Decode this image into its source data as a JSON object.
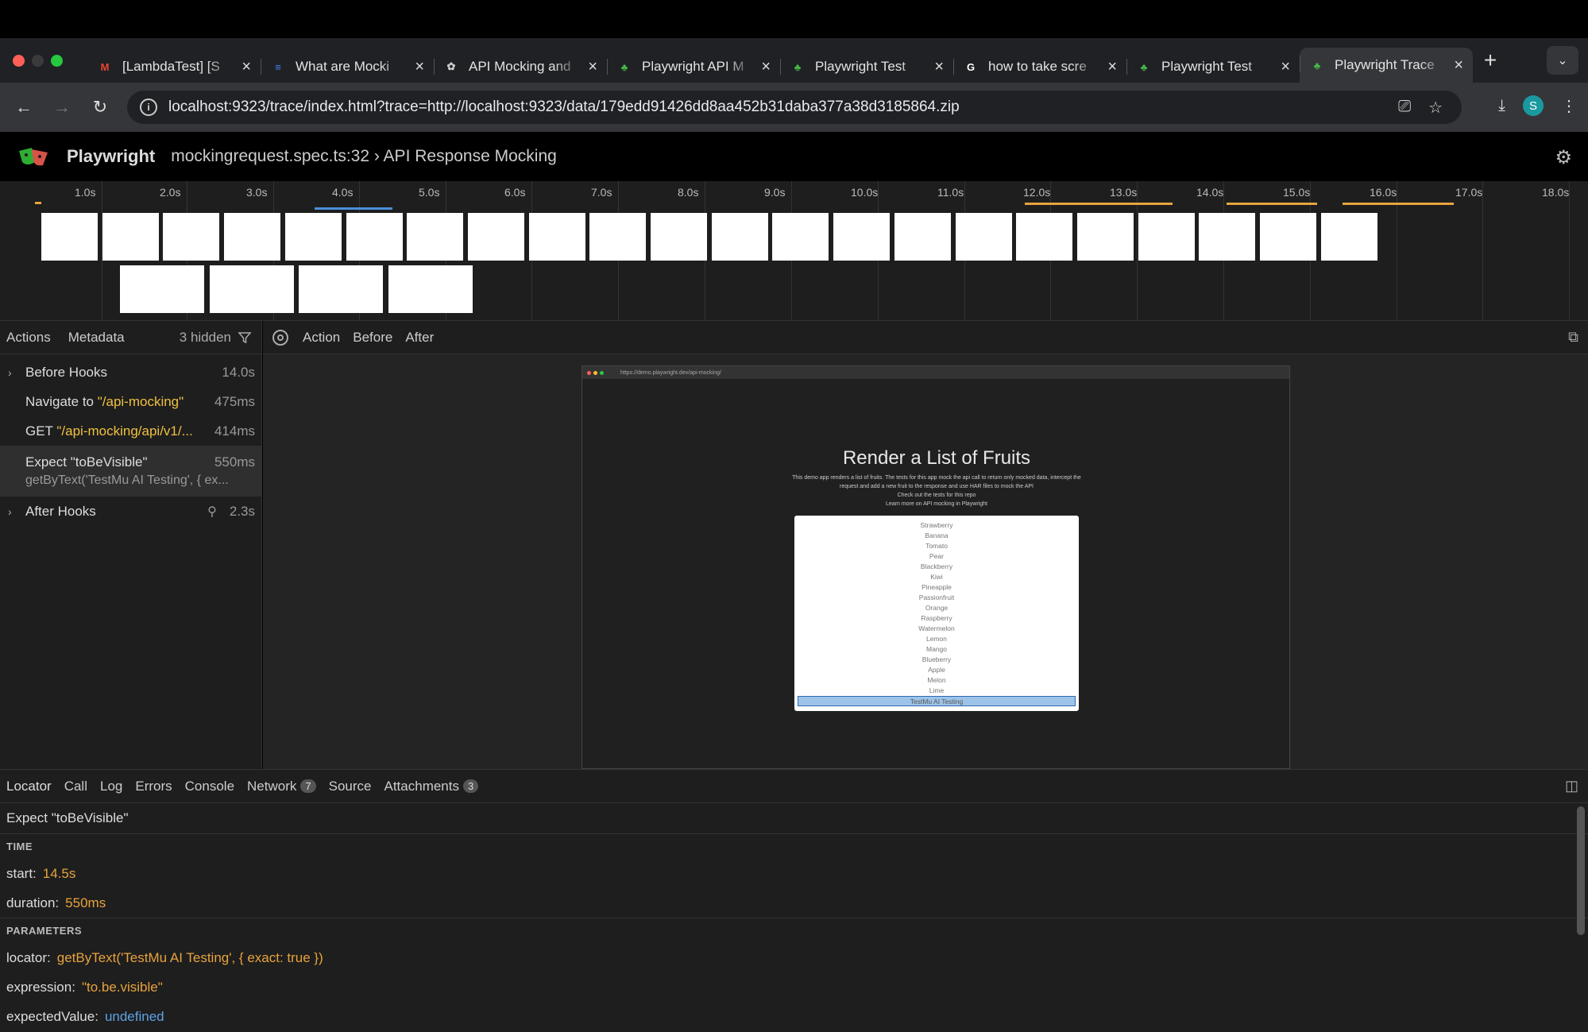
{
  "browser": {
    "tabs": [
      {
        "title": "[LambdaTest] [S",
        "icon": "gmail-icon",
        "color": "#ea4335",
        "glyph": "M"
      },
      {
        "title": "What are Mocki",
        "icon": "docs-icon",
        "color": "#4285f4",
        "glyph": "≡"
      },
      {
        "title": "API Mocking and",
        "icon": "openai-icon",
        "color": "#cccccc",
        "glyph": "✿"
      },
      {
        "title": "Playwright API M",
        "icon": "playwright-icon",
        "color": "#45ba4b",
        "glyph": "♣"
      },
      {
        "title": "Playwright Test",
        "icon": "playwright-icon",
        "color": "#45ba4b",
        "glyph": "♣"
      },
      {
        "title": "how to take scre",
        "icon": "google-icon",
        "color": "#ffffff",
        "glyph": "G"
      },
      {
        "title": "Playwright Test",
        "icon": "playwright-icon",
        "color": "#45ba4b",
        "glyph": "♣"
      },
      {
        "title": "Playwright Trace",
        "icon": "playwright-icon",
        "color": "#45ba4b",
        "glyph": "♣",
        "active": true
      }
    ],
    "url": "localhost:9323/trace/index.html?trace=http://localhost:9323/data/179edd91426dd8aa452b31daba377a38d3185864.zip",
    "profile_initial": "S"
  },
  "header": {
    "app_name": "Playwright",
    "title": "mockingrequest.spec.ts:32 › API Response Mocking"
  },
  "timeline": {
    "labels": [
      "1.0s",
      "2.0s",
      "3.0s",
      "4.0s",
      "5.0s",
      "6.0s",
      "7.0s",
      "8.0s",
      "9.0s",
      "10.0s",
      "11.0s",
      "12.0s",
      "13.0s",
      "14.0s",
      "15.0s",
      "16.0s",
      "17.0s",
      "18.0s"
    ]
  },
  "left_panel": {
    "tabs": [
      "Actions",
      "Metadata"
    ],
    "hidden_label": "3 hidden",
    "actions": [
      {
        "name": "Before Hooks",
        "duration": "14.0s",
        "expandable": true
      },
      {
        "prefix": "Navigate to ",
        "highlight": "\"/api-mocking\"",
        "duration": "475ms"
      },
      {
        "prefix": "GET ",
        "highlight": "\"/api-mocking/api/v1/...",
        "duration": "414ms"
      },
      {
        "name": "Expect \"toBeVisible\"",
        "sub": "getByText('TestMu AI Testing', { ex...",
        "duration": "550ms",
        "selected": true
      },
      {
        "name": "After Hooks",
        "duration": "2.3s",
        "expandable": true,
        "attachment": true
      }
    ]
  },
  "snapshot": {
    "tabs": [
      "Action",
      "Before",
      "After"
    ],
    "url": "https://demo.playwright.dev/api-mocking/",
    "heading": "Render a List of Fruits",
    "paragraph_lines": [
      "This demo app renders a list of fruits. The tests for this app mock the api call to return only mocked data, intercept the",
      "request and add a new fruit to the response and use HAR files to mock the API",
      "Check out the tests for this repo",
      "Learn more on API mocking in Playwright"
    ],
    "fruits": [
      "Strawberry",
      "Banana",
      "Tomato",
      "Pear",
      "Blackberry",
      "Kiwi",
      "Pineapple",
      "Passionfruit",
      "Orange",
      "Raspberry",
      "Watermelon",
      "Lemon",
      "Mango",
      "Blueberry",
      "Apple",
      "Melon",
      "Lime",
      "TestMu AI Testing"
    ]
  },
  "bottom_panel": {
    "tabs": [
      {
        "label": "Locator"
      },
      {
        "label": "Call"
      },
      {
        "label": "Log"
      },
      {
        "label": "Errors"
      },
      {
        "label": "Console"
      },
      {
        "label": "Network",
        "badge": "7"
      },
      {
        "label": "Source"
      },
      {
        "label": "Attachments",
        "badge": "3"
      }
    ],
    "action_title": "Expect \"toBeVisible\"",
    "time_heading": "TIME",
    "start_key": "start:",
    "start_val": "14.5s",
    "duration_key": "duration:",
    "duration_val": "550ms",
    "params_heading": "PARAMETERS",
    "locator_key": "locator:",
    "locator_val": "getByText('TestMu AI Testing', { exact: true })",
    "expression_key": "expression:",
    "expression_val": "\"to.be.visible\"",
    "expected_key": "expectedValue:",
    "expected_val": "undefined"
  }
}
